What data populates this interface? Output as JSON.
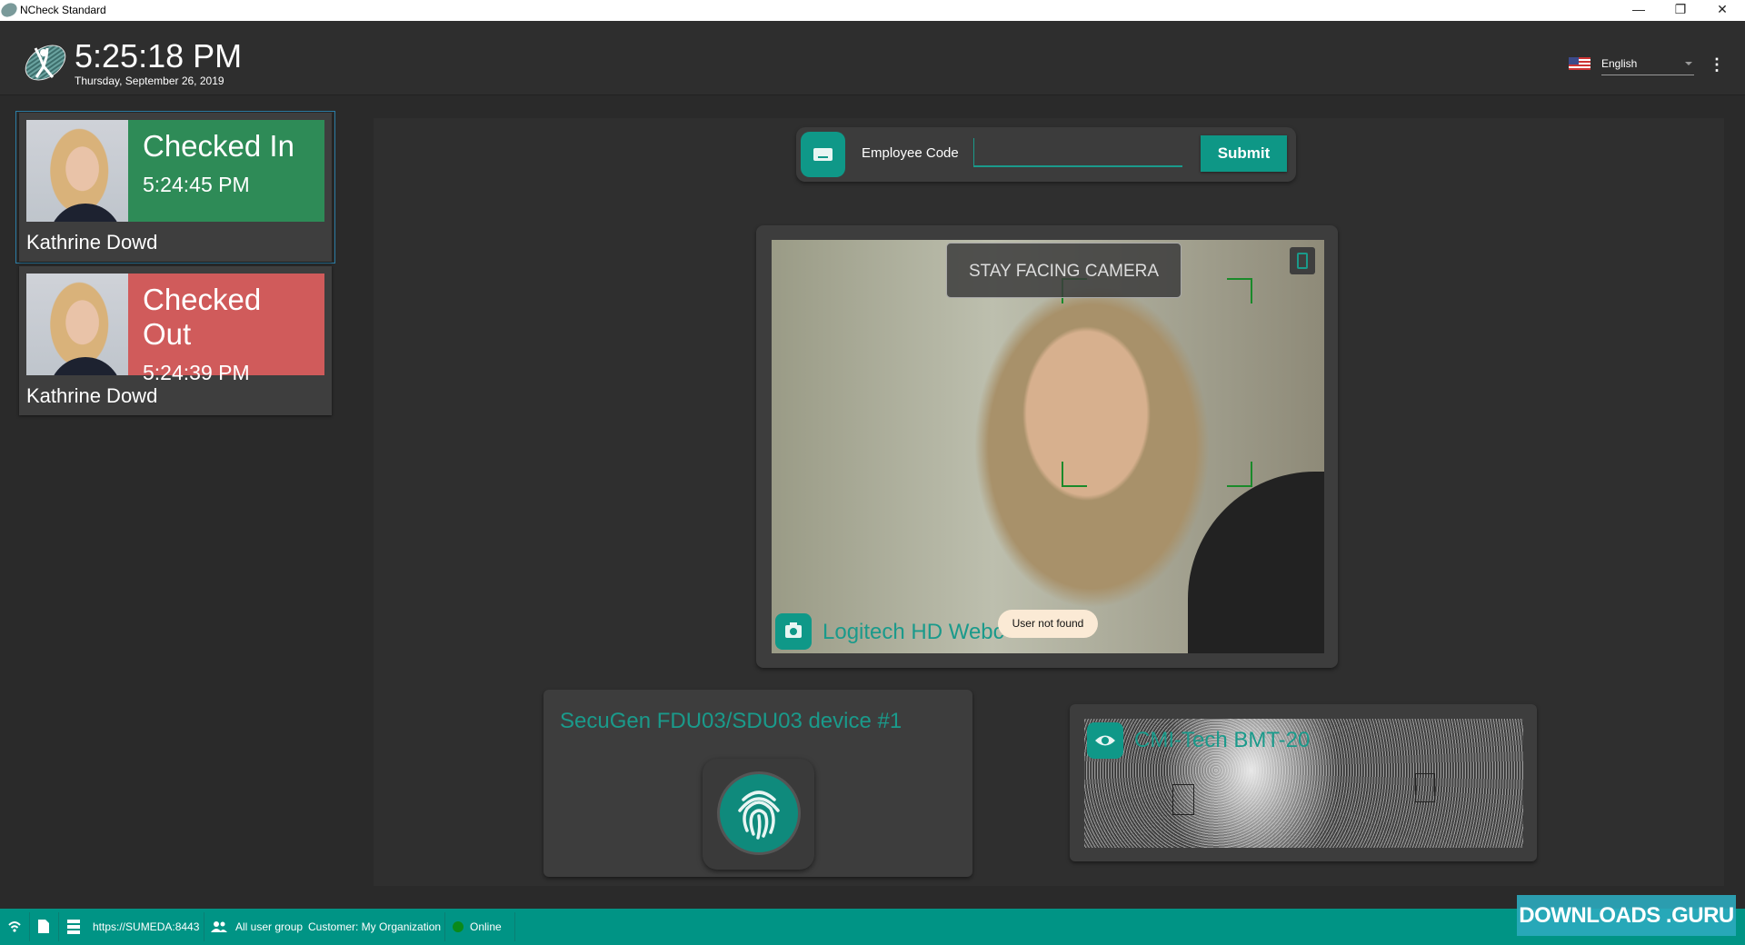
{
  "window": {
    "title": "NCheck Standard",
    "controls": [
      "minimize",
      "restore",
      "close"
    ]
  },
  "header": {
    "time": "5:25:18 PM",
    "date": "Thursday, September 26, 2019",
    "language": "English"
  },
  "events": [
    {
      "status": "Checked In",
      "time": "5:24:45 PM",
      "name": "Kathrine Dowd",
      "color": "#2e8b57"
    },
    {
      "status": "Checked Out",
      "time": "5:24:39 PM",
      "name": "Kathrine Dowd",
      "color": "#d05b5b"
    }
  ],
  "code_entry": {
    "label": "Employee Code",
    "value": "",
    "submit": "Submit"
  },
  "camera": {
    "hint": "STAY FACING CAMERA",
    "device": "Logitech HD Webc",
    "toast": "User not found"
  },
  "fingerprint": {
    "device": "SecuGen FDU03/SDU03 device #1"
  },
  "iris": {
    "device": "CMI-Tech BMT-20"
  },
  "statusbar": {
    "server": "https://SUMEDA:8443",
    "group": "All user group",
    "customer": "Customer: My Organization",
    "connection": "Online"
  },
  "watermark": "DOWNLOADS .GURU",
  "colors": {
    "accent": "#009485",
    "checked_in": "#2e8b57",
    "checked_out": "#d05b5b",
    "online": "#0a8a1a"
  }
}
